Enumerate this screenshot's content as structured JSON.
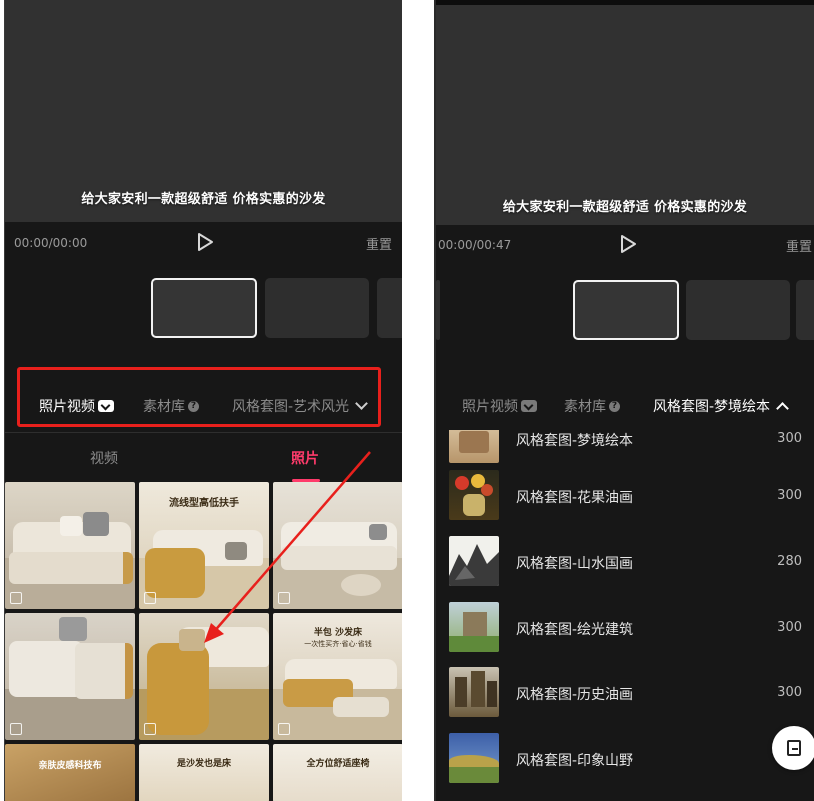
{
  "left_panel": {
    "preview": {
      "subtitle": "给大家安利一款超级舒适 价格实惠的沙发"
    },
    "controls": {
      "time": "00:00/00:00",
      "reset_label": "重置"
    },
    "category_tabs": [
      {
        "label": "照片视频",
        "active": true
      },
      {
        "label": "素材库",
        "active": false
      },
      {
        "label": "风格套图-艺术风光",
        "active": false
      }
    ],
    "sub_tabs": [
      {
        "label": "视频",
        "active": false
      },
      {
        "label": "照片",
        "active": true
      }
    ],
    "photo_captions": {
      "tile2_title": "流线型高低扶手",
      "tile6_title": "半包 沙发床",
      "tile6_sub": "一次性买齐·省心·省钱",
      "tile7_title": "亲肤皮感科技布",
      "tile8_title": "是沙发也是床",
      "tile9_title": "全方位舒适座椅"
    },
    "annotation_color": "#e8201c"
  },
  "right_panel": {
    "preview": {
      "subtitle": "给大家安利一款超级舒适 价格实惠的沙发"
    },
    "controls": {
      "time": "00:00/00:47",
      "reset_label": "重置"
    },
    "category_tabs": [
      {
        "label": "照片视频",
        "active": false
      },
      {
        "label": "素材库",
        "active": false
      },
      {
        "label": "风格套图-梦境绘本",
        "active": true
      }
    ],
    "style_list": [
      {
        "name": "风格套图-梦境绘本",
        "count": "300",
        "icon": "dream-picturebook-thumb"
      },
      {
        "name": "风格套图-花果油画",
        "count": "300",
        "icon": "flower-oil-painting-thumb"
      },
      {
        "name": "风格套图-山水国画",
        "count": "280",
        "icon": "landscape-ink-painting-thumb"
      },
      {
        "name": "风格套图-绘光建筑",
        "count": "300",
        "icon": "light-architecture-thumb"
      },
      {
        "name": "风格套图-历史油画",
        "count": "300",
        "icon": "history-oil-painting-thumb"
      },
      {
        "name": "风格套图-印象山野",
        "count": "",
        "icon": "impression-landscape-thumb"
      }
    ]
  },
  "colors": {
    "accent": "#ff3b6b",
    "background": "#171717",
    "preview": "#313131",
    "highlight": "#e8201c"
  }
}
